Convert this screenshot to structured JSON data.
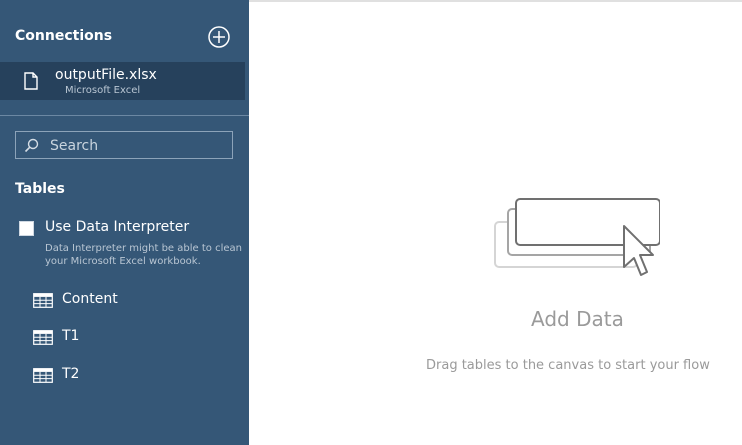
{
  "connections": {
    "title": "Connections",
    "items": [
      {
        "name": "outputFile.xlsx",
        "type": "Microsoft Excel"
      }
    ]
  },
  "search": {
    "placeholder": "Search"
  },
  "tables": {
    "title": "Tables",
    "interpreter": {
      "label": "Use Data Interpreter",
      "checked": false,
      "description": "Data Interpreter might be able to clean your Microsoft Excel workbook."
    },
    "items": [
      {
        "label": "Content"
      },
      {
        "label": "T1"
      },
      {
        "label": "T2"
      }
    ]
  },
  "canvas": {
    "title": "Add Data",
    "hint": "Drag tables to the canvas to start your flow"
  },
  "colors": {
    "sidebar": "#355777",
    "selected": "#26415c",
    "muted_text": "#9a9a9a"
  }
}
